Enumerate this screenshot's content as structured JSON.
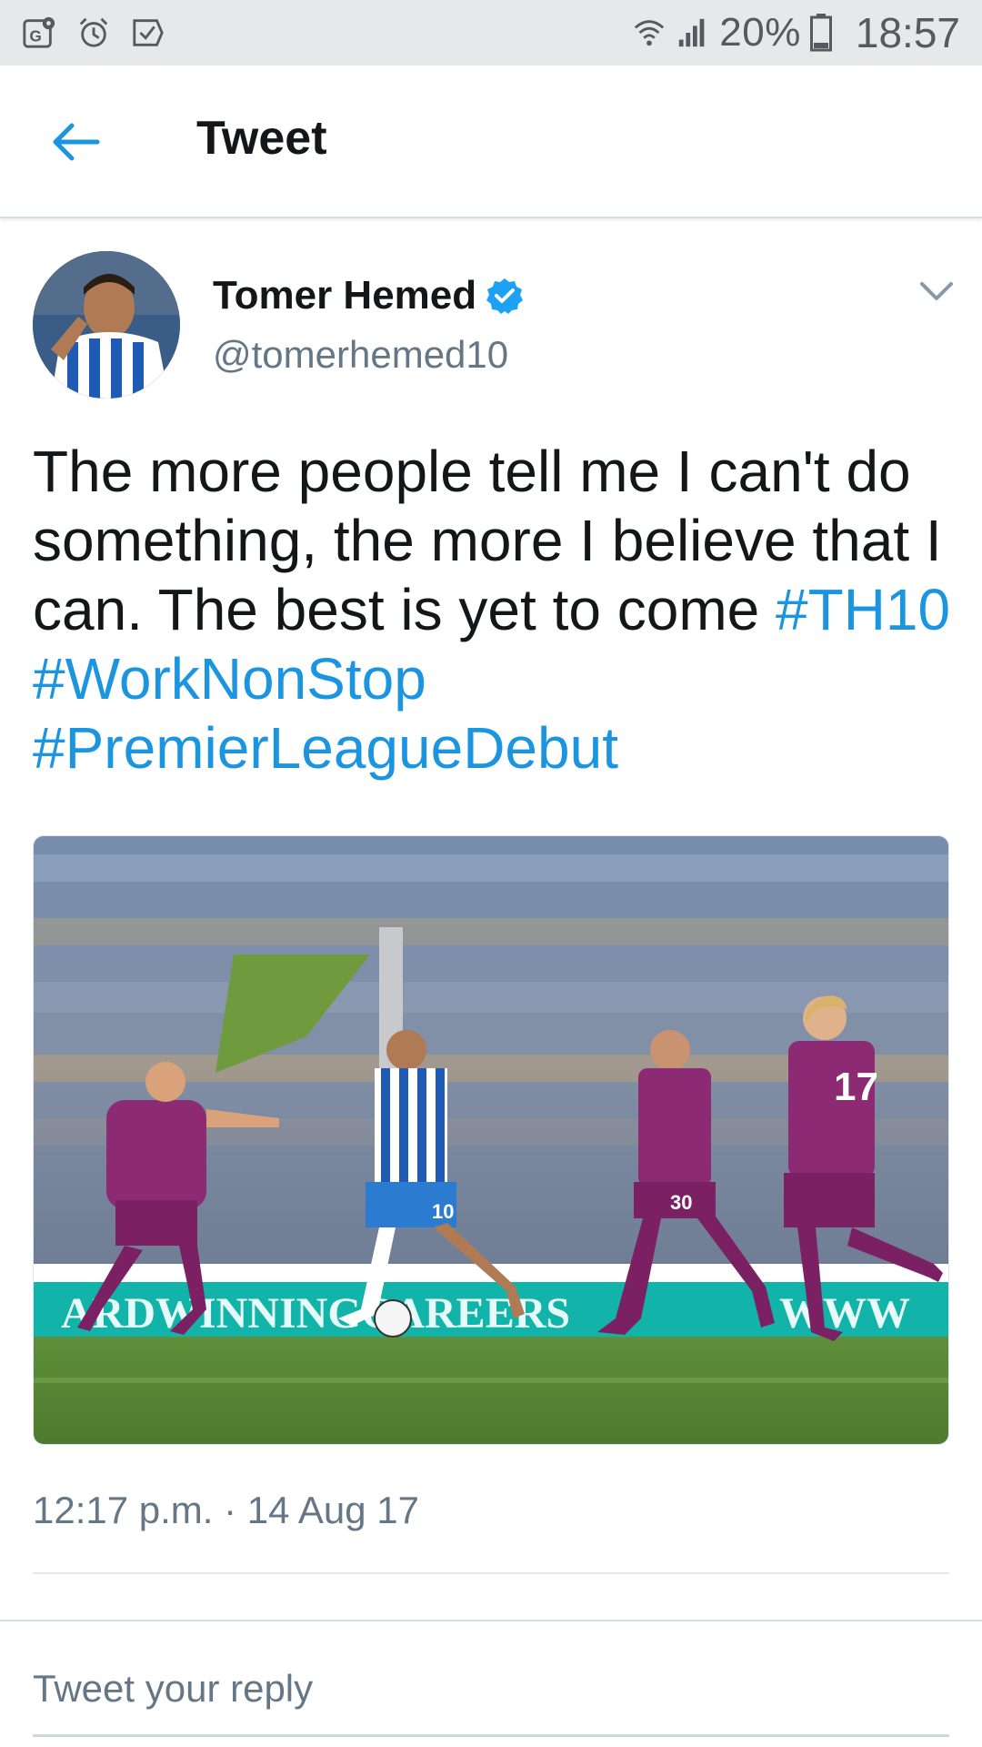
{
  "status_bar": {
    "battery_percent": "20%",
    "time": "18:57",
    "icons": [
      "map-icon",
      "alarm-icon",
      "check-icon",
      "wifi-icon",
      "signal-icon",
      "battery-icon"
    ]
  },
  "header": {
    "title": "Tweet",
    "back_icon": "back-arrow-icon"
  },
  "tweet": {
    "author_name": "Tomer Hemed",
    "verified": true,
    "handle": "@tomerhemed10",
    "text_main": "The more people tell me I can't do something, the more I believe that I can. The best is yet to come",
    "hashtags": [
      "#TH10",
      "#WorkNonStop",
      "#PremierLeagueDebut"
    ],
    "timestamp": "12:17 p.m. · 14 Aug 17"
  },
  "media": {
    "player_number_center": "10",
    "player_number_right1": "30",
    "player_number_right2": "17"
  },
  "reply": {
    "placeholder": "Tweet your reply"
  },
  "colors": {
    "accent": "#1b95e0",
    "verified": "#1da1f2",
    "secondary_text": "#657786",
    "status_bar_bg": "#e6e8ea"
  }
}
